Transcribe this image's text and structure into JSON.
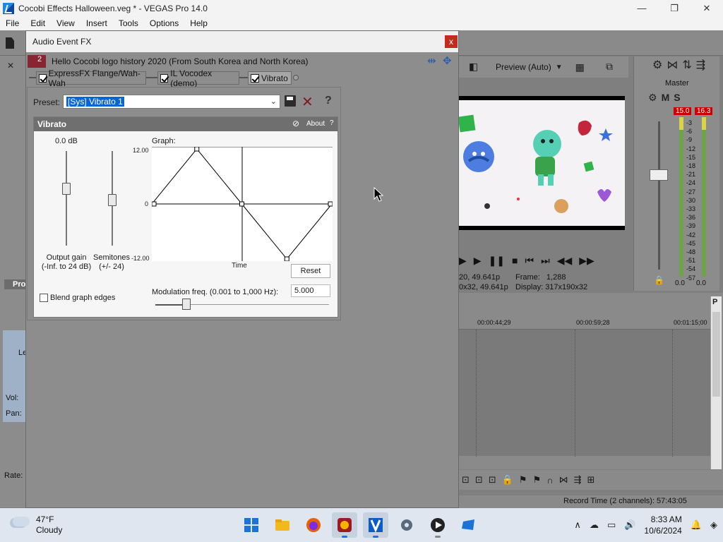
{
  "window": {
    "title": "Cocobi Effects Halloween.veg * - VEGAS Pro 14.0",
    "minimize": "—",
    "restore": "❐",
    "close": "✕"
  },
  "menu": [
    "File",
    "Edit",
    "View",
    "Insert",
    "Tools",
    "Options",
    "Help"
  ],
  "left_panel": {
    "pro_label": "Pro",
    "track_label_partial": "Le",
    "vol_label": "Vol:",
    "pan_label": "Pan:",
    "rate_label": "Rate:"
  },
  "dialog": {
    "title": "Audio Event FX",
    "close": "x",
    "chain_number": "2",
    "chain_title": "Hello Cocobi logo history 2020 (From South Korea and North Korea)",
    "plugins": [
      {
        "label": "ExpressFX Flange/Wah-Wah",
        "checked": true
      },
      {
        "label": "IL Vocodex (demo)",
        "checked": true
      },
      {
        "label": "Vibrato",
        "checked": true
      }
    ],
    "preset_label": "Preset:",
    "preset_value": "[Sys] Vibrato 1",
    "help_glyph": "?",
    "vibrato": {
      "header": "Vibrato",
      "about": "About",
      "about_q": "?",
      "output_gain_value": "0.0 dB",
      "output_gain_label": "Output gain",
      "output_gain_range": "(-Inf. to 24 dB)",
      "semitones_label": "Semitones",
      "semitones_range": "(+/- 24)",
      "graph_label": "Graph:",
      "y_max": "12.00",
      "y_zero": "0",
      "y_min": "-12.00",
      "x_label": "Time",
      "reset": "Reset",
      "blend_label": "Blend graph edges",
      "blend_checked": false,
      "mod_label": "Modulation freq. (0.001 to 1,000 Hz):",
      "mod_value": "5.000",
      "graph_points": [
        [
          0,
          0
        ],
        [
          0.25,
          12
        ],
        [
          0.5,
          0
        ],
        [
          0.75,
          -12
        ],
        [
          1.0,
          0
        ]
      ]
    }
  },
  "preview": {
    "mode": "Preview (Auto)",
    "info_left_1": "20, 49.641p",
    "info_left_2": "0x32, 49.641p",
    "frame_label": "Frame:",
    "frame_value": "1,288",
    "display_label": "Display:",
    "display_value": "317x190x32"
  },
  "master": {
    "title": "Master",
    "mute": "M",
    "solo": "S",
    "peak_left": "15.0",
    "peak_right": "16.3",
    "scale": [
      "3",
      "6",
      "9",
      "12",
      "15",
      "18",
      "21",
      "24",
      "27",
      "30",
      "33",
      "36",
      "39",
      "42",
      "45",
      "48",
      "51",
      "54",
      "57"
    ],
    "bottom_left": "0.0",
    "bottom_right": "0.0"
  },
  "timeline": {
    "ruler": [
      "00:00:44;29",
      "00:00:59;28",
      "00:01:15;00"
    ],
    "marker_p": "P"
  },
  "status": {
    "record_time": "Record Time (2 channels): 57:43:05"
  },
  "taskbar": {
    "temp": "47°F",
    "condition": "Cloudy",
    "time": "8:33 AM",
    "date": "10/6/2024",
    "tray_chevron": "∧"
  },
  "colors": {
    "accent_blue": "#0a64d8",
    "close_red": "#c42b1c",
    "chain_red": "#8b2431",
    "peak_red": "#cc0000"
  }
}
